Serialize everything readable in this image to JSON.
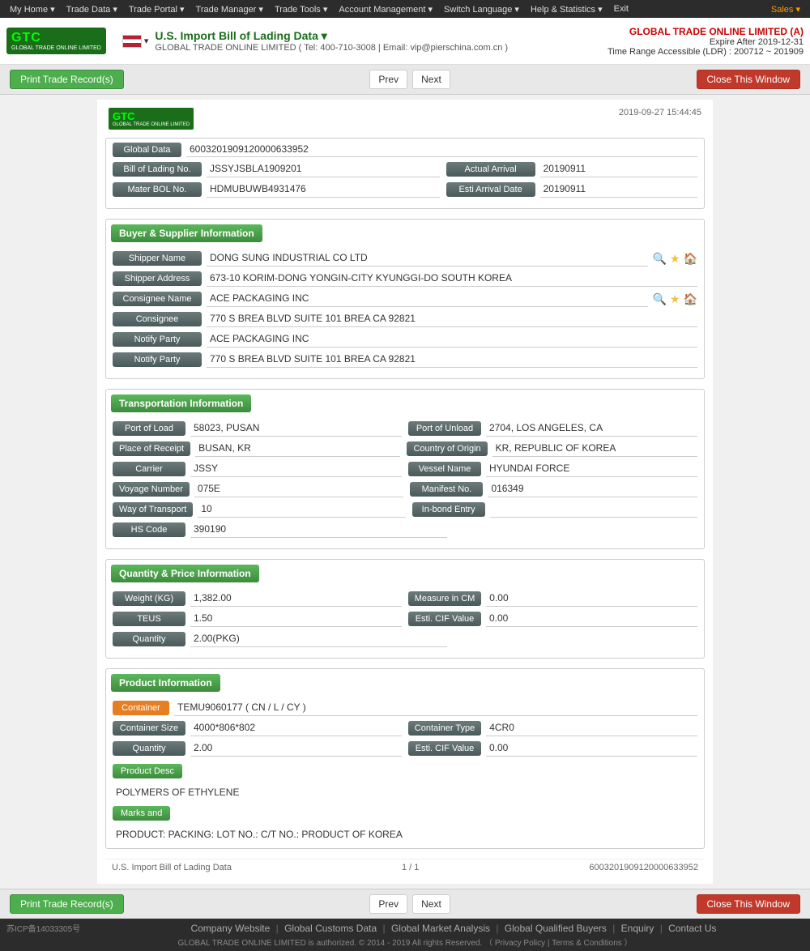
{
  "nav": {
    "items": [
      "My Home ▾",
      "Trade Data ▾",
      "Trade Portal ▾",
      "Trade Manager ▾",
      "Trade Tools ▾",
      "Account Management ▾",
      "Switch Language ▾",
      "Help & Statistics ▾",
      "Exit"
    ],
    "sales": "Sales ▾"
  },
  "header": {
    "logo_text": "GTC",
    "logo_sub": "GLOBAL TRADE ONLINE LIMITED",
    "title": "U.S. Import Bill of Lading Data  ▾",
    "contact": "GLOBAL TRADE ONLINE LIMITED ( Tel: 400-710-3008 | Email: vip@pierschina.com.cn )",
    "company": "GLOBAL TRADE ONLINE LIMITED (A)",
    "expire": "Expire After 2019-12-31",
    "time_range": "Time Range Accessible (LDR) : 200712 ~ 201909"
  },
  "toolbar": {
    "print_label": "Print Trade Record(s)",
    "prev_label": "Prev",
    "next_label": "Next",
    "close_label": "Close This Window"
  },
  "record": {
    "timestamp": "2019-09-27 15:44:45",
    "global_data_label": "Global Data",
    "global_data_value": "6003201909120000633952",
    "bol_label": "Bill of Lading No.",
    "bol_value": "JSSYJSBLA1909201",
    "actual_arrival_label": "Actual Arrival",
    "actual_arrival_value": "20190911",
    "master_bol_label": "Mater BOL No.",
    "master_bol_value": "HDMUBUWB4931476",
    "esti_arrival_label": "Esti Arrival Date",
    "esti_arrival_value": "20190911"
  },
  "buyer_supplier": {
    "section_title": "Buyer & Supplier Information",
    "shipper_name_label": "Shipper Name",
    "shipper_name_value": "DONG SUNG INDUSTRIAL CO LTD",
    "shipper_address_label": "Shipper Address",
    "shipper_address_value": "673-10 KORIM-DONG YONGIN-CITY KYUNGGI-DO SOUTH KOREA",
    "consignee_name_label": "Consignee Name",
    "consignee_name_value": "ACE PACKAGING INC",
    "consignee_label": "Consignee",
    "consignee_value": "770 S BREA BLVD SUITE 101 BREA CA 92821",
    "notify_party_label": "Notify Party",
    "notify_party_value": "ACE PACKAGING INC",
    "notify_party2_label": "Notify Party",
    "notify_party2_value": "770 S BREA BLVD SUITE 101 BREA CA 92821"
  },
  "transportation": {
    "section_title": "Transportation Information",
    "port_load_label": "Port of Load",
    "port_load_value": "58023, PUSAN",
    "port_unload_label": "Port of Unload",
    "port_unload_value": "2704, LOS ANGELES, CA",
    "place_receipt_label": "Place of Receipt",
    "place_receipt_value": "BUSAN, KR",
    "country_origin_label": "Country of Origin",
    "country_origin_value": "KR, REPUBLIC OF KOREA",
    "carrier_label": "Carrier",
    "carrier_value": "JSSY",
    "vessel_name_label": "Vessel Name",
    "vessel_name_value": "HYUNDAI FORCE",
    "voyage_number_label": "Voyage Number",
    "voyage_number_value": "075E",
    "manifest_label": "Manifest No.",
    "manifest_value": "016349",
    "way_transport_label": "Way of Transport",
    "way_transport_value": "10",
    "inbond_label": "In-bond Entry",
    "inbond_value": "",
    "hs_code_label": "HS Code",
    "hs_code_value": "390190"
  },
  "quantity_price": {
    "section_title": "Quantity & Price Information",
    "weight_label": "Weight (KG)",
    "weight_value": "1,382.00",
    "measure_cm_label": "Measure in CM",
    "measure_cm_value": "0.00",
    "teus_label": "TEUS",
    "teus_value": "1.50",
    "esti_cif_label": "Esti. CIF Value",
    "esti_cif_value": "0.00",
    "quantity_label": "Quantity",
    "quantity_value": "2.00(PKG)"
  },
  "product": {
    "section_title": "Product Information",
    "container_label": "Container",
    "container_value": "TEMU9060177 ( CN / L / CY )",
    "container_size_label": "Container Size",
    "container_size_value": "4000*806*802",
    "container_type_label": "Container Type",
    "container_type_value": "4CR0",
    "quantity_label": "Quantity",
    "quantity_value": "2.00",
    "esti_cif_label": "Esti. CIF Value",
    "esti_cif_value": "0.00",
    "product_desc_btn": "Product Desc",
    "product_desc_text": "POLYMERS OF ETHYLENE",
    "marks_btn": "Marks and",
    "marks_text": "PRODUCT: PACKING: LOT NO.: C/T NO.: PRODUCT OF KOREA"
  },
  "record_footer": {
    "left_text": "U.S. Import Bill of Lading Data",
    "middle_text": "1 / 1",
    "right_text": "6003201909120000633952"
  },
  "footer": {
    "icp": "苏ICP备14033305号",
    "links": [
      "Company Website",
      "Global Customs Data",
      "Global Market Analysis",
      "Global Qualified Buyers",
      "Enquiry",
      "Contact Us"
    ],
    "copyright": "GLOBAL TRADE ONLINE LIMITED is authorized. © 2014 - 2019 All rights Reserved.  （ Privacy Policy | Terms & Conditions ）"
  }
}
